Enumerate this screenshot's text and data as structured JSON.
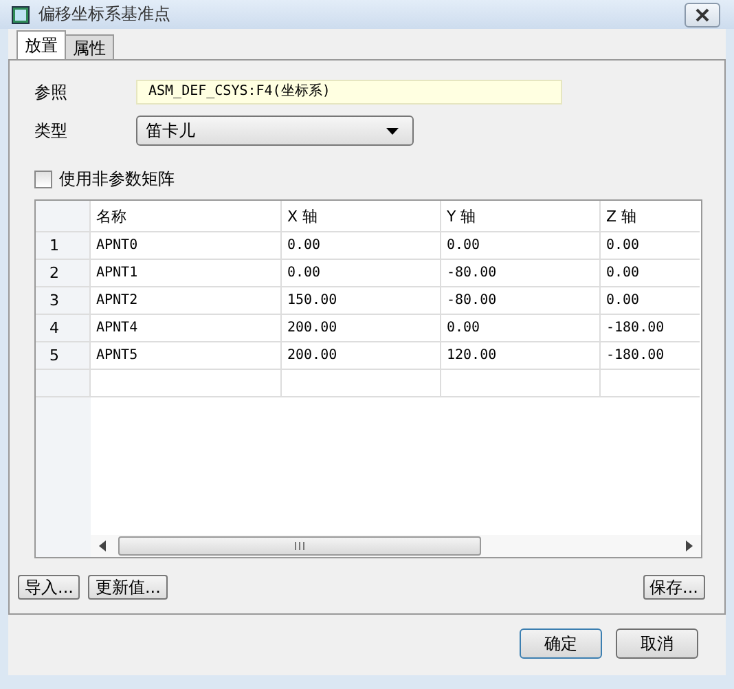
{
  "window": {
    "title": "偏移坐标系基准点"
  },
  "tabs": [
    {
      "label": "放置",
      "selected": true
    },
    {
      "label": "属性",
      "selected": false
    }
  ],
  "reference": {
    "label": "参照",
    "value": "ASM_DEF_CSYS:F4(坐标系)"
  },
  "type": {
    "label": "类型",
    "value": "笛卡儿"
  },
  "nonparametric": {
    "label": "使用非参数矩阵",
    "checked": false
  },
  "table": {
    "columns": [
      "名称",
      "X 轴",
      "Y 轴",
      "Z 轴"
    ],
    "rows": [
      {
        "index": "1",
        "cells": [
          "APNT0",
          "0.00",
          "0.00",
          "0.00"
        ]
      },
      {
        "index": "2",
        "cells": [
          "APNT1",
          "0.00",
          "-80.00",
          "0.00"
        ]
      },
      {
        "index": "3",
        "cells": [
          "APNT2",
          "150.00",
          "-80.00",
          "0.00"
        ]
      },
      {
        "index": "4",
        "cells": [
          "APNT4",
          "200.00",
          "0.00",
          "-180.00"
        ]
      },
      {
        "index": "5",
        "cells": [
          "APNT5",
          "200.00",
          "120.00",
          "-180.00"
        ]
      }
    ]
  },
  "actions": [
    "导入...",
    "更新值..."
  ],
  "save": "保存...",
  "buttons": [
    "确定",
    "取消"
  ]
}
